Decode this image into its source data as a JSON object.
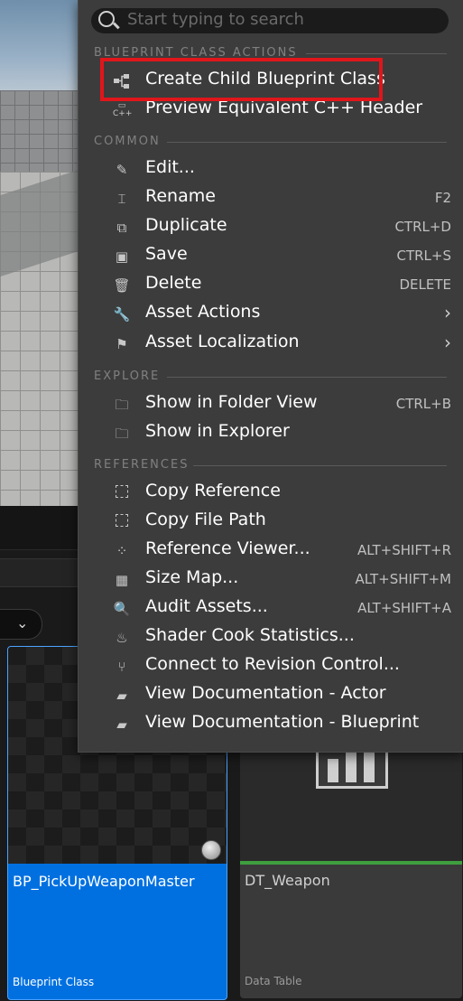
{
  "search": {
    "placeholder": "Start typing to search"
  },
  "sections": {
    "blueprint": "BLUEPRINT CLASS ACTIONS",
    "common": "COMMON",
    "explore": "EXPLORE",
    "references": "REFERENCES"
  },
  "blueprint_items": [
    {
      "label": "Create Child Blueprint Class",
      "icon": "blueprint-hierarchy-icon"
    },
    {
      "label": "Preview Equivalent C++ Header",
      "icon": "cpp-header-icon"
    }
  ],
  "common_items": [
    {
      "label": "Edit...",
      "shortcut": "",
      "icon": "pencil-icon"
    },
    {
      "label": "Rename",
      "shortcut": "F2",
      "icon": "rename-icon"
    },
    {
      "label": "Duplicate",
      "shortcut": "CTRL+D",
      "icon": "duplicate-icon"
    },
    {
      "label": "Save",
      "shortcut": "CTRL+S",
      "icon": "save-icon"
    },
    {
      "label": "Delete",
      "shortcut": "DELETE",
      "icon": "trash-icon"
    },
    {
      "label": "Asset Actions",
      "shortcut": "",
      "icon": "wrench-icon"
    },
    {
      "label": "Asset Localization",
      "shortcut": "",
      "icon": "flag-icon"
    }
  ],
  "explore_items": [
    {
      "label": "Show in Folder View",
      "shortcut": "CTRL+B",
      "icon": "folder-search-icon"
    },
    {
      "label": "Show in Explorer",
      "shortcut": "",
      "icon": "folder-search-icon"
    }
  ],
  "reference_items": [
    {
      "label": "Copy Reference",
      "shortcut": "",
      "icon": "copy-reference-icon"
    },
    {
      "label": "Copy File Path",
      "shortcut": "",
      "icon": "copy-path-icon"
    },
    {
      "label": "Reference Viewer...",
      "shortcut": "ALT+SHIFT+R",
      "icon": "reference-viewer-icon"
    },
    {
      "label": "Size Map...",
      "shortcut": "ALT+SHIFT+M",
      "icon": "size-map-icon"
    },
    {
      "label": "Audit Assets...",
      "shortcut": "ALT+SHIFT+A",
      "icon": "audit-icon"
    },
    {
      "label": "Shader Cook Statistics...",
      "shortcut": "",
      "icon": "shader-bowl-icon"
    },
    {
      "label": "Connect to Revision Control...",
      "shortcut": "",
      "icon": "branch-icon"
    },
    {
      "label": "View Documentation - Actor",
      "shortcut": "",
      "icon": "book-icon"
    },
    {
      "label": "View Documentation - Blueprint",
      "shortcut": "",
      "icon": "book-icon"
    }
  ],
  "submenu_arrow": "›",
  "assets": [
    {
      "name": "BP_PickUpWeaponMaster",
      "type": "Blueprint Class"
    },
    {
      "name": "DT_Weapon",
      "type": "Data Table"
    }
  ],
  "colors": {
    "highlight": "#e0161b",
    "selected_tile": "#0070e0",
    "data_table_accent": "#3f9f3f"
  }
}
